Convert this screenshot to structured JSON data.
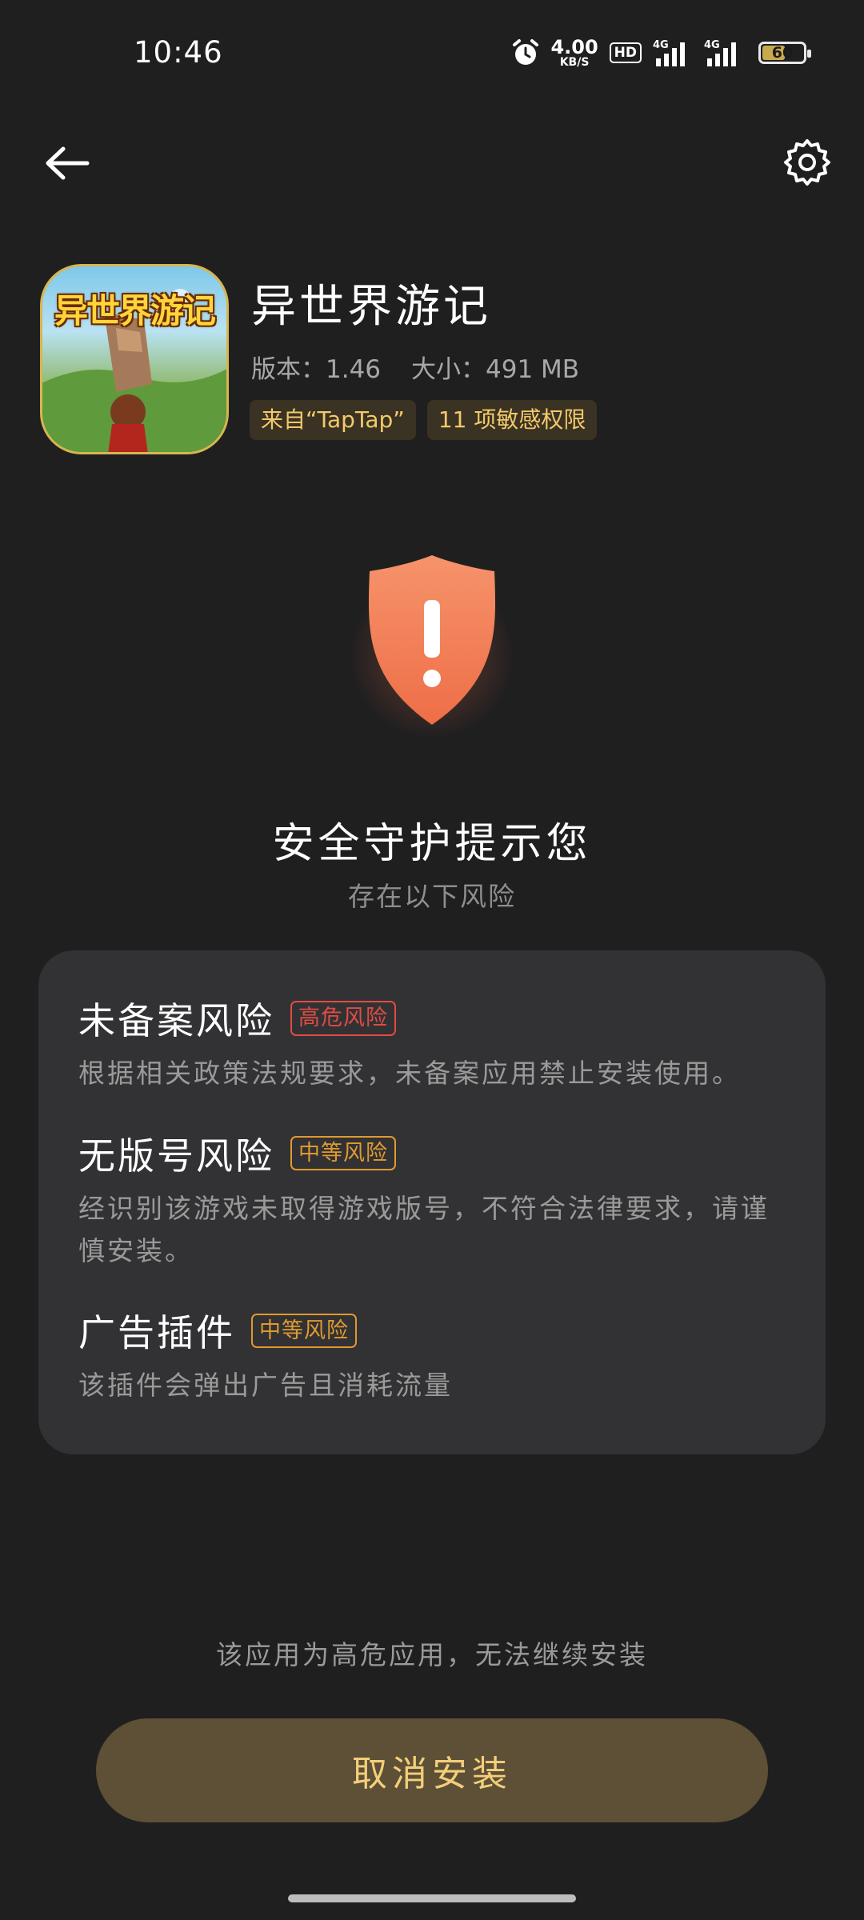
{
  "status_bar": {
    "time": "10:46",
    "net_speed_value": "4.00",
    "net_speed_unit": "KB/S",
    "hd_label": "HD",
    "signal1_label": "4G",
    "signal2_label": "4G",
    "battery_level": "60",
    "battery_percent": 60
  },
  "nav": {
    "back_icon": "arrow-left-icon",
    "settings_icon": "gear-icon"
  },
  "app": {
    "icon_text": "异世界游记",
    "name": "异世界游记",
    "version_text": "版本：1.46",
    "size_text": "大小：491 MB",
    "tags": [
      "来自“TapTap”",
      "11 项敏感权限"
    ]
  },
  "warning": {
    "shield_icon": "shield-exclamation-icon",
    "title": "安全守护提示您",
    "subtitle": "存在以下风险"
  },
  "risks": [
    {
      "title": "未备案风险",
      "badge": "高危风险",
      "level": "high",
      "description": "根据相关政策法规要求，未备案应用禁止安装使用。"
    },
    {
      "title": "无版号风险",
      "badge": "中等风险",
      "level": "mid",
      "description": "经识别该游戏未取得游戏版号，不符合法律要求，请谨慎安装。"
    },
    {
      "title": "广告插件",
      "badge": "中等风险",
      "level": "mid",
      "description": "该插件会弹出广告且消耗流量"
    }
  ],
  "footer": {
    "note": "该应用为高危应用，无法继续安装",
    "cancel_label": "取消安装"
  },
  "colors": {
    "background": "#1f1f20",
    "card": "#323234",
    "high_risk": "#e24b45",
    "mid_risk": "#e09a30",
    "tag_text": "#f3c96a",
    "button_bg": "#5d5037",
    "button_text": "#f4cf7a",
    "shield": "#f07c55"
  }
}
